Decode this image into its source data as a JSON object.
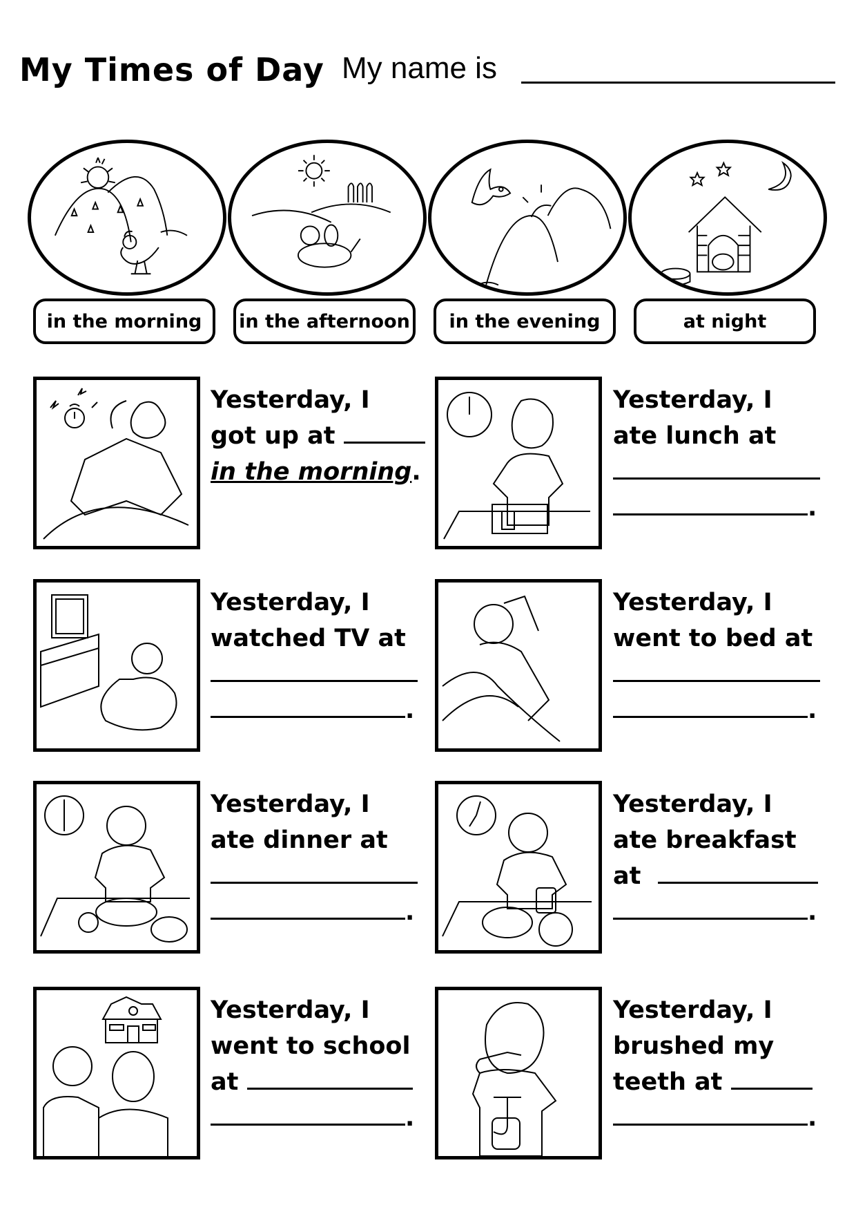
{
  "header": {
    "title": "My Times of Day",
    "name_label": "My name is"
  },
  "times_of_day": [
    {
      "label": "in the morning",
      "scene": "sunrise-rooster"
    },
    {
      "label": "in the afternoon",
      "scene": "sun-dog-field"
    },
    {
      "label": "in the evening",
      "scene": "sunset-bird-hills"
    },
    {
      "label": "at night",
      "scene": "moon-doghouse"
    }
  ],
  "exercises": [
    {
      "picture": "alarm-clock-wake-up",
      "lines": [
        "Yesterday, I",
        "got up at"
      ],
      "answer": "in the morning",
      "suffix": "."
    },
    {
      "picture": "eating-lunch",
      "lines": [
        "Yesterday, I",
        "ate lunch at"
      ],
      "answer": "",
      "suffix": "."
    },
    {
      "picture": "watching-tv",
      "lines": [
        "Yesterday, I",
        "watched TV at"
      ],
      "answer": "",
      "suffix": "."
    },
    {
      "picture": "going-to-bed",
      "lines": [
        "Yesterday, I",
        "went to bed at"
      ],
      "answer": "",
      "suffix": "."
    },
    {
      "picture": "eating-dinner",
      "lines": [
        "Yesterday, I",
        "ate dinner at"
      ],
      "answer": "",
      "suffix": "."
    },
    {
      "picture": "eating-breakfast",
      "lines": [
        "Yesterday, I",
        "ate breakfast",
        "at"
      ],
      "answer": "",
      "suffix": "."
    },
    {
      "picture": "going-to-school",
      "lines": [
        "Yesterday, I",
        "went to school",
        "at"
      ],
      "answer": "",
      "suffix": "."
    },
    {
      "picture": "brushing-teeth",
      "lines": [
        "Yesterday, I",
        "brushed my",
        "teeth at"
      ],
      "answer": "",
      "suffix": "."
    }
  ]
}
